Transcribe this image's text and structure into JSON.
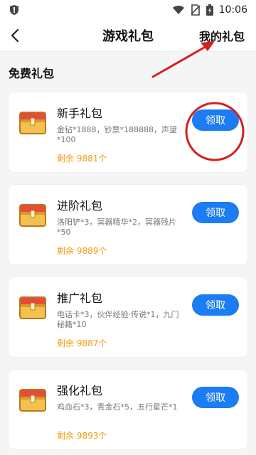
{
  "status_bar": {
    "time": "10:06",
    "icons": [
      "shield-icon",
      "wifi-icon",
      "no-sim-icon",
      "battery-icon"
    ]
  },
  "nav": {
    "title": "游戏礼包",
    "right_link": "我的礼包",
    "back_icon": "back-arrow-icon"
  },
  "section_title": "免费礼包",
  "gifts": [
    {
      "title": "新手礼包",
      "desc": "金钻*1888，钞票*188888，声望*100",
      "remain": "剩余 9881个",
      "button": "领取"
    },
    {
      "title": "进阶礼包",
      "desc": "洛阳铲*3，冥器精华*2，冥器残片*50",
      "remain": "剩余 9889个",
      "button": "领取"
    },
    {
      "title": "推广礼包",
      "desc": "电话卡*3，伙伴经验·传说*1，九门秘籍*10",
      "remain": "剩余 9887个",
      "button": "领取"
    },
    {
      "title": "强化礼包",
      "desc": "鸡血石*3，青金石*5，五行星芒*1",
      "remain": "剩余 9893个",
      "button": "领取"
    }
  ],
  "colors": {
    "accent": "#1b7cf3",
    "remain": "#f39c12",
    "annotation": "#d42020"
  }
}
